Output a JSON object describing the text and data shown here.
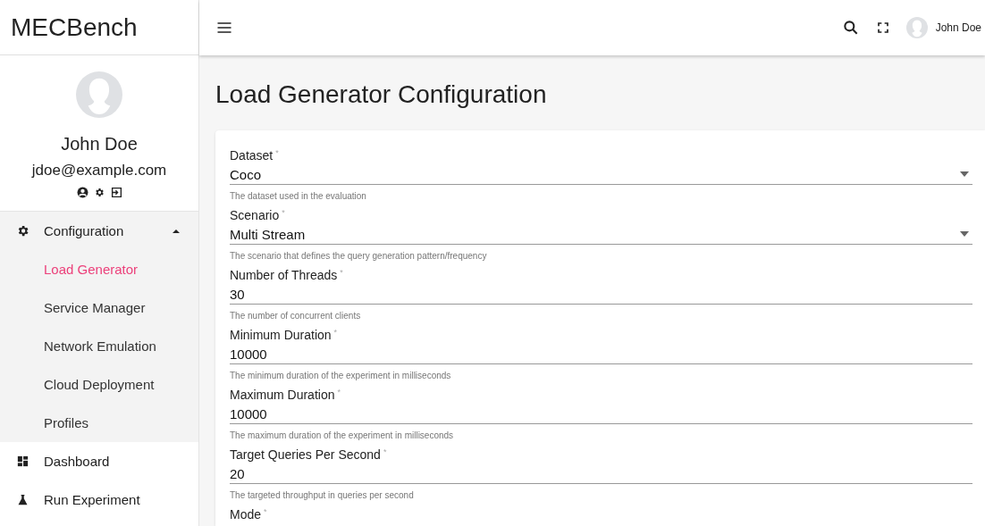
{
  "app": {
    "title": "MECBench"
  },
  "user": {
    "name": "John Doe",
    "email": "jdoe@example.com"
  },
  "sidebar": {
    "items": [
      {
        "label": "Configuration",
        "expanded": true,
        "children": [
          {
            "label": "Load Generator",
            "selected": true
          },
          {
            "label": "Service Manager",
            "selected": false
          },
          {
            "label": "Network Emulation",
            "selected": false
          },
          {
            "label": "Cloud Deployment",
            "selected": false
          },
          {
            "label": "Profiles",
            "selected": false
          }
        ]
      },
      {
        "label": "Dashboard",
        "expanded": false
      },
      {
        "label": "Run Experiment",
        "expanded": false
      }
    ]
  },
  "topbar": {
    "user_name": "John Doe"
  },
  "page": {
    "title": "Load Generator Configuration"
  },
  "form": {
    "fields": [
      {
        "kind": "select",
        "label": "Dataset",
        "required_mark": "*",
        "value": "Coco",
        "hint": "The dataset used in the evaluation"
      },
      {
        "kind": "select",
        "label": "Scenario",
        "required_mark": "*",
        "value": "Multi Stream",
        "hint": "The scenario that defines the query generation pattern/frequency"
      },
      {
        "kind": "input",
        "label": "Number of Threads",
        "required_mark": "*",
        "value": "30",
        "hint": "The number of concurrent clients"
      },
      {
        "kind": "input",
        "label": "Minimum Duration",
        "required_mark": "*",
        "value": "10000",
        "hint": "The minimum duration of the experiment in milliseconds"
      },
      {
        "kind": "input",
        "label": "Maximum Duration",
        "required_mark": "*",
        "value": "10000",
        "hint": "The maximum duration of the experiment in milliseconds"
      },
      {
        "kind": "input",
        "label": "Target Queries Per Second",
        "required_mark": "*",
        "value": "20",
        "hint": "The targeted throughput in queries per second"
      },
      {
        "kind": "label_only",
        "label": "Mode",
        "required_mark": "*"
      }
    ]
  }
}
